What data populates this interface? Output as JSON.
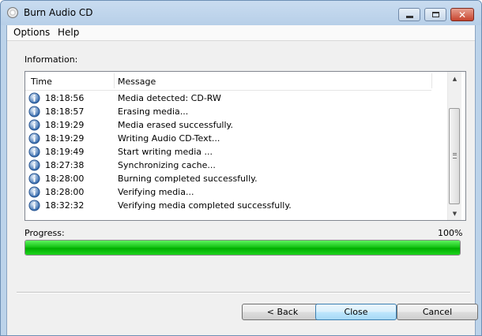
{
  "window": {
    "title": "Burn Audio CD"
  },
  "menu": {
    "options": "Options",
    "help": "Help"
  },
  "info": {
    "label": "Information:",
    "columns": {
      "time": "Time",
      "message": "Message"
    },
    "rows": [
      {
        "time": "18:18:56",
        "message": "Media detected: CD-RW"
      },
      {
        "time": "18:18:57",
        "message": "Erasing media..."
      },
      {
        "time": "18:19:29",
        "message": "Media erased successfully."
      },
      {
        "time": "18:19:29",
        "message": "Writing Audio CD-Text..."
      },
      {
        "time": "18:19:49",
        "message": "Start writing media ..."
      },
      {
        "time": "18:27:38",
        "message": "Synchronizing cache..."
      },
      {
        "time": "18:28:00",
        "message": "Burning completed successfully."
      },
      {
        "time": "18:28:00",
        "message": "Verifying media..."
      },
      {
        "time": "18:32:32",
        "message": "Verifying media completed successfully."
      }
    ]
  },
  "progress": {
    "label": "Progress:",
    "value_text": "100%",
    "fraction": 1.0
  },
  "buttons": {
    "back": "< Back",
    "close": "Close",
    "cancel": "Cancel"
  },
  "icons": {
    "row": "info-icon",
    "app": "cd-icon"
  }
}
